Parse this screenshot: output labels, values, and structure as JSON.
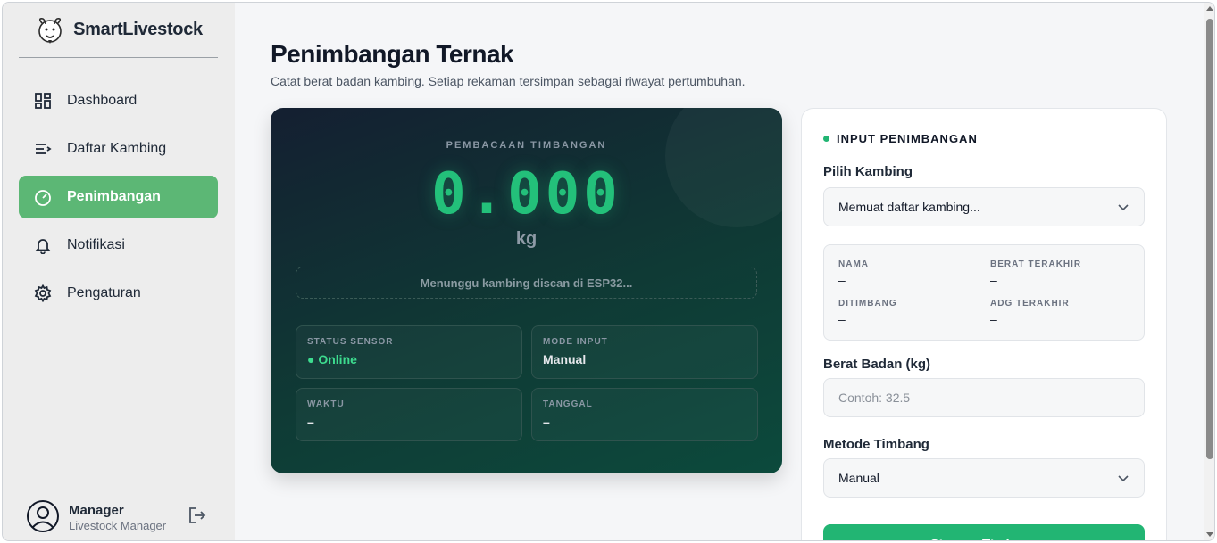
{
  "brand": {
    "name": "SmartLivestock",
    "logo_icon": "goat-logo-icon"
  },
  "sidebar": {
    "items": [
      {
        "label": "Dashboard",
        "icon": "dashboard-grid-icon",
        "active": false
      },
      {
        "label": "Daftar Kambing",
        "icon": "list-icon",
        "active": false
      },
      {
        "label": "Penimbangan",
        "icon": "gauge-icon",
        "active": true
      },
      {
        "label": "Notifikasi",
        "icon": "bell-icon",
        "active": false
      },
      {
        "label": "Pengaturan",
        "icon": "gear-icon",
        "active": false
      }
    ],
    "accent_color": "#5cb775"
  },
  "user": {
    "name": "Manager",
    "role": "Livestock Manager"
  },
  "page": {
    "title": "Penimbangan Ternak",
    "subtitle": "Catat berat badan kambing. Setiap rekaman tersimpan sebagai riwayat pertumbuhan."
  },
  "scale": {
    "label": "PEMBACAAN TIMBANGAN",
    "value": "0.000",
    "unit": "kg",
    "scan_message": "Menunggu kambing discan di ESP32...",
    "tiles": {
      "status": {
        "label": "STATUS SENSOR",
        "value": "● Online"
      },
      "mode": {
        "label": "MODE INPUT",
        "value": "Manual"
      },
      "time": {
        "label": "WAKTU",
        "value": "–"
      },
      "date": {
        "label": "TANGGAL",
        "value": "–"
      }
    }
  },
  "form": {
    "heading": "INPUT PENIMBANGAN",
    "goat_label": "Pilih Kambing",
    "goat_select": "Memuat daftar kambing...",
    "details": {
      "name_label": "NAMA",
      "name_value": "–",
      "last_weight_label": "BERAT TERAKHIR",
      "last_weight_value": "–",
      "weighed_label": "DITIMBANG",
      "weighed_value": "–",
      "adg_label": "ADG TERAKHIR",
      "adg_value": "–"
    },
    "weight_label": "Berat Badan (kg)",
    "weight_placeholder": "Contoh: 32.5",
    "method_label": "Metode Timbang",
    "method_select": "Manual",
    "submit_label": "Simpan Timbang",
    "accent_color": "#22b573"
  }
}
